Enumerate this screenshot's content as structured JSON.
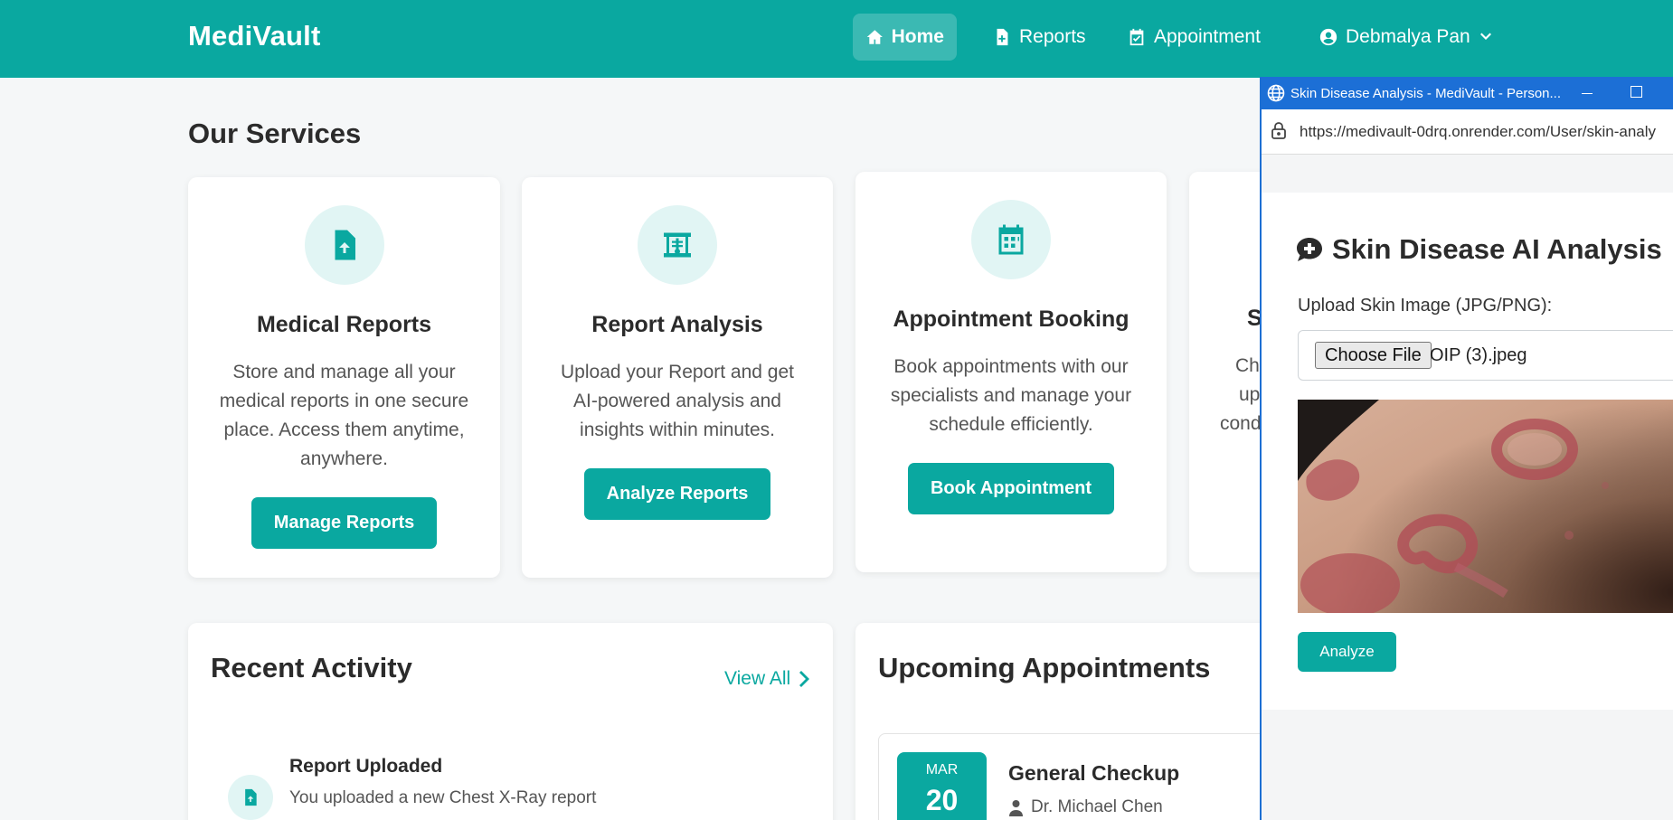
{
  "brand": "MediVault",
  "nav": {
    "home": "Home",
    "reports": "Reports",
    "appointment": "Appointment",
    "user": "Debmalya Pan"
  },
  "services": {
    "title": "Our Services",
    "cards": [
      {
        "title": "Medical Reports",
        "desc": "Store and manage all your medical reports in one secure place. Access them anytime, anywhere.",
        "button": "Manage Reports",
        "icon": "file-upload-icon"
      },
      {
        "title": "Report Analysis",
        "desc": "Upload your Report and get AI-powered analysis and insights within minutes.",
        "button": "Analyze Reports",
        "icon": "xray-icon"
      },
      {
        "title": "Appointment Booking",
        "desc": "Book appointments with our specialists and manage your schedule efficiently.",
        "button": "Book Appointment",
        "icon": "calendar-icon"
      },
      {
        "title": "S",
        "desc_lines": [
          "Cha",
          "up",
          "cond"
        ],
        "icon": ""
      }
    ]
  },
  "recent_activity": {
    "title": "Recent Activity",
    "view_all": "View All",
    "items": [
      {
        "title": "Report Uploaded",
        "desc": "You uploaded a new Chest X-Ray report"
      }
    ]
  },
  "upcoming": {
    "title": "Upcoming Appointments",
    "items": [
      {
        "month": "MAR",
        "day": "20",
        "title": "General Checkup",
        "doctor": "Dr. Michael Chen"
      }
    ]
  },
  "popup": {
    "window_title": "Skin Disease Analysis - MediVault - Person...",
    "url": "https://medivault-0drq.onrender.com/User/skin-analy",
    "heading": "Skin Disease AI Analysis",
    "upload_label": "Upload Skin Image (JPG/PNG):",
    "choose_file": "Choose File",
    "file_name": "OIP (3).jpeg",
    "analyze": "Analyze"
  },
  "colors": {
    "brand": "#0aa8a0",
    "popup_titlebar": "#1c6fd6",
    "icon_bg": "#e1f5f4"
  }
}
